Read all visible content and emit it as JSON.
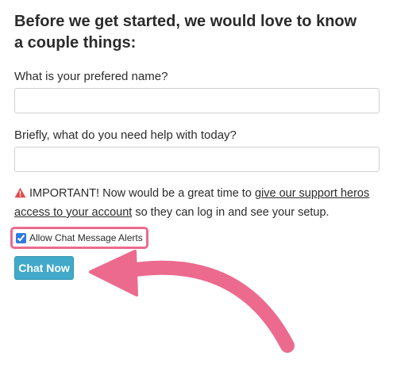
{
  "form": {
    "heading": "Before we get started, we would love to know a couple things:",
    "name_label": "What is your prefered name?",
    "name_value": "",
    "help_label": "Briefly, what do you need help with today?",
    "help_value": "",
    "notice": {
      "icon": "warning-triangle-icon",
      "before": "IMPORTANT! Now would be a great time to ",
      "link": "give our support heros access to your account",
      "after": " so they can log in and see your setup."
    },
    "alert_checkbox": {
      "label": "Allow Chat Message Alerts",
      "checked": true
    },
    "chat_button_label": "Chat Now"
  },
  "annotation": {
    "highlight_color": "#ec6a8e",
    "arrow_color": "#ec6a8e",
    "arrow_icon": "curved-arrow-icon"
  },
  "colors": {
    "button": "#41a9c9",
    "warning": "#e04b4b"
  }
}
